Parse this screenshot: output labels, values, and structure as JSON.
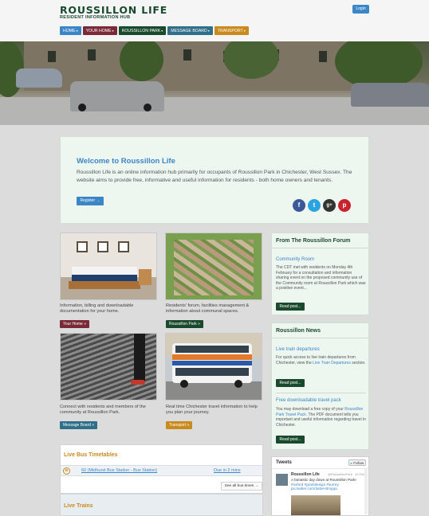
{
  "site": {
    "title": "ROUSSILLON LIFE",
    "subtitle": "RESIDENT INFORMATION HUB",
    "login_label": "Login"
  },
  "nav": [
    {
      "label": "HOME",
      "color": "#3a86c6"
    },
    {
      "label": "YOUR HOME",
      "color": "#7a2a36"
    },
    {
      "label": "ROUSSILLON PARK",
      "color": "#1a4a2e"
    },
    {
      "label": "MESSAGE BOARD",
      "color": "#2f6f8a"
    },
    {
      "label": "TRANSPORT",
      "color": "#c98a1e"
    }
  ],
  "welcome": {
    "heading": "Welcome to Roussillon Life",
    "body": "Roussillon Life is an online information hub primarily for occupants of Roussillon Park in Chichester, West Sussex. The website aims to provide free, informative and useful information for residents - both home owners and tenants.",
    "register_label": "Register →"
  },
  "social": [
    {
      "icon": "facebook-icon",
      "glyph": "f",
      "color": "#3b5998"
    },
    {
      "icon": "twitter-icon",
      "glyph": "t",
      "color": "#2ba3e1"
    },
    {
      "icon": "google-plus-icon",
      "glyph": "g+",
      "color": "#333333"
    },
    {
      "icon": "pinterest-icon",
      "glyph": "p",
      "color": "#c8232c"
    }
  ],
  "tiles": [
    {
      "caption": "Information, billing and downloadable documentation for your home.",
      "button": "Your Home »",
      "color": "#7a2a36"
    },
    {
      "caption": "Residents' forum, facilities management & information about communal spaces.",
      "button": "Roussillon Park »",
      "color": "#1a4a2e"
    },
    {
      "caption": "Connect with residents and members of the community at Roussillon Park.",
      "button": "Message Board »",
      "color": "#2f6f8a"
    },
    {
      "caption": "Real time Chichester travel information to help you plan your journey.",
      "button": "Transport »",
      "color": "#c98a1e"
    }
  ],
  "forum": {
    "heading": "From The Roussillon Forum",
    "post_title": "Community Room",
    "post_text": "The CDT met with residents on Monday 4th February for a consultation and information sharing event on the proposed community use of the Community room at Roussillon Park which was a positive event...",
    "read_label": "Read post..."
  },
  "news": {
    "heading": "Roussillon News",
    "items": [
      {
        "title": "Live train departures",
        "text_before": "For quick access to live train departures from Chichester, view the ",
        "link": "Live Train Departures",
        "text_after": " section.",
        "read_label": "Read post..."
      },
      {
        "title": "Free downloadable travel pack",
        "text_before": "You may download a free copy of your ",
        "link": "Roussillon Park Travel Pack.",
        "text_after": " The PDF document tells you important and useful information regarding travel in Chichester.",
        "read_label": "Read post..."
      }
    ]
  },
  "tweets": {
    "title": "Tweets",
    "follow_label": "Follow",
    "name": "Roussillon Life",
    "handle": "@RoussillonPark",
    "date": "10 Feb",
    "text": "A fantastic day down at Roussillon Park!",
    "hashtags": "#oxford #grantdesign #surrey",
    "link": "pic.twitter.com/3a5vH3mgqa"
  },
  "bus": {
    "heading": "Live Bus Timetables",
    "icon_text": "B",
    "route": "60 (Midhurst Bus Station - Bus Station)",
    "due": "Due in 2 mins",
    "all_label": "See all bus times →"
  },
  "trains": {
    "heading": "Live Trains"
  }
}
